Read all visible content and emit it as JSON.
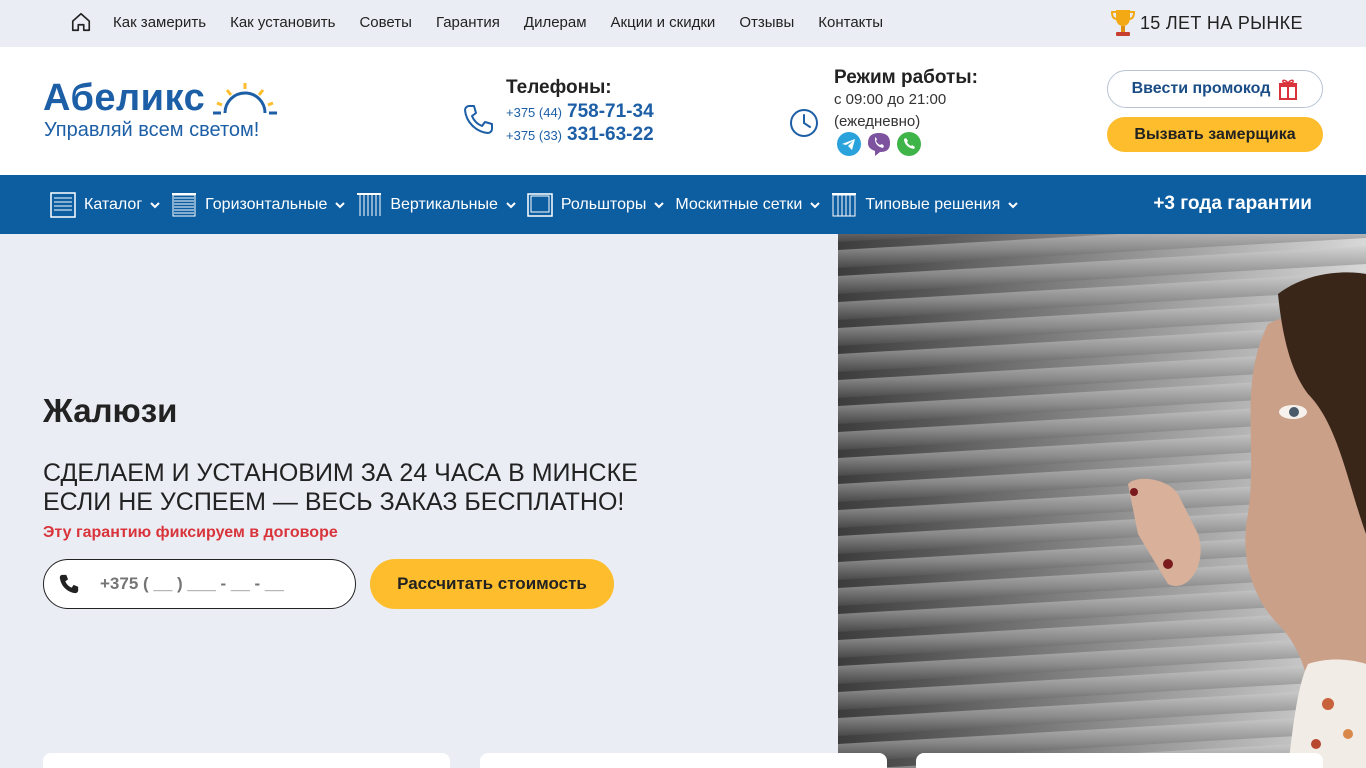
{
  "topbar": {
    "links": [
      "Как замерить",
      "Как установить",
      "Советы",
      "Гарантия",
      "Дилерам",
      "Акции и скидки",
      "Отзывы",
      "Контакты"
    ],
    "years": "15 ЛЕТ НА РЫНКЕ"
  },
  "header": {
    "logo_name": "Абеликс",
    "logo_slogan": "Управляй всем светом!",
    "phones_title": "Телефоны:",
    "phone1_code": "+375 (44)",
    "phone1_num": "758-71-34",
    "phone2_code": "+375 (33)",
    "phone2_num": "331-63-22",
    "hours_title": "Режим работы:",
    "hours_line1": "с 09:00 до 21:00",
    "hours_line2": "(ежедневно)",
    "promo_label": "Ввести промокод",
    "measure_label": "Вызвать замерщика"
  },
  "nav": {
    "items": [
      {
        "label": "Каталог"
      },
      {
        "label": "Горизонтальные"
      },
      {
        "label": "Вертикальные"
      },
      {
        "label": "Рольшторы"
      },
      {
        "label": "Москитные сетки"
      },
      {
        "label": "Типовые решения"
      }
    ],
    "guarantee": "+3 года гарантии"
  },
  "hero": {
    "title": "Жалюзи",
    "sub1": "СДЕЛАЕМ И УСТАНОВИМ ЗА 24 ЧАСА В МИНСКЕ",
    "sub2": "ЕСЛИ НЕ УСПЕЕМ — ВЕСЬ ЗАКАЗ БЕСПЛАТНО!",
    "note": "Эту гарантию фиксируем в договоре",
    "phone_placeholder": "+375 ( __ ) ___ - __ - __",
    "calc_label": "Рассчитать стоимость"
  },
  "colors": {
    "brand_blue": "#0d5ea0",
    "accent_yellow": "#fdbd2c",
    "note_red": "#d9343b"
  }
}
